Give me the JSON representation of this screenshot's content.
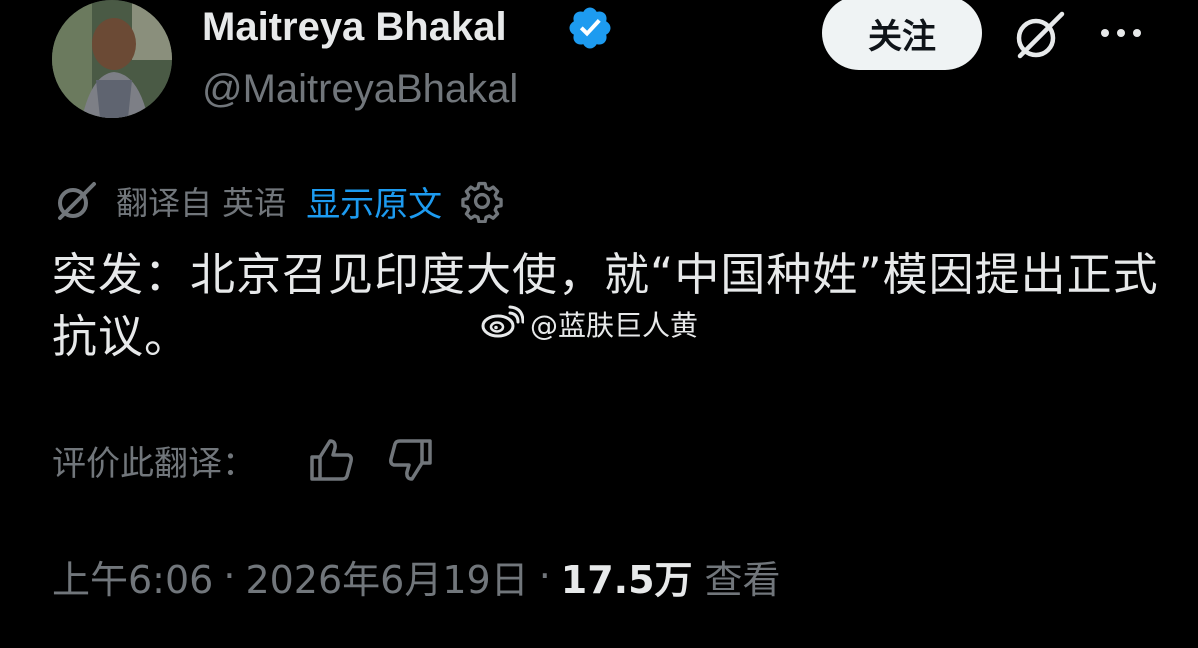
{
  "author": {
    "name": "Maitreya Bhakal",
    "handle": "@MaitreyaBhakal",
    "verified_color": "#1d9bf0"
  },
  "header": {
    "follow_label": "关注",
    "grok_icon": "grok-icon",
    "more_icon": "more-icon"
  },
  "translation": {
    "label": "翻译自 英语",
    "show_original": "显示原文",
    "settings_icon": "gear-icon"
  },
  "tweet": {
    "text": "突发：北京召见印度大使，就“中国种姓”模因提出正式抗议。"
  },
  "watermark": {
    "text": "@蓝肤巨人黄"
  },
  "rating": {
    "label": "评价此翻译："
  },
  "meta": {
    "time": "上午6:06",
    "date": "2026年6月19日",
    "views": "17.5万",
    "views_label": "查看",
    "separator": "·"
  },
  "colors": {
    "background": "#000000",
    "text": "#e7e9ea",
    "muted": "#71767b",
    "link": "#1d9bf0"
  }
}
